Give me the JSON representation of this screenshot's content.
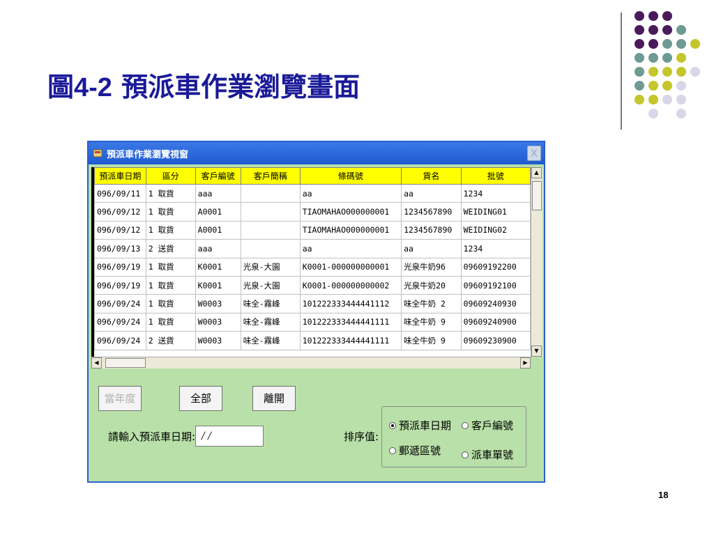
{
  "slide": {
    "title_prefix": "圖",
    "title_num": "4-2",
    "title_text": " 預派車作業瀏覽畫面",
    "page_number": "18",
    "colors": {
      "purple": "#4b1a5c",
      "teal": "#6e9a94",
      "olive": "#c4c62a",
      "lavender": "#d8d6e8"
    }
  },
  "window": {
    "title": "預派車作業瀏覽視窗",
    "close_label": "X"
  },
  "grid": {
    "columns": [
      "預派車日期",
      "區分",
      "客戶編號",
      "客戶簡稱",
      "條碼號",
      "貨名",
      "批號"
    ],
    "rows": [
      [
        "096/09/11",
        "1 取貨",
        "aaa",
        "",
        "aa",
        "aa",
        "1234"
      ],
      [
        "096/09/12",
        "1 取貨",
        "A0001",
        "",
        "TIAOMAHAO000000001",
        "1234567890",
        "WEIDING01"
      ],
      [
        "096/09/12",
        "1 取貨",
        "A0001",
        "",
        "TIAOMAHAO000000001",
        "1234567890",
        "WEIDING02"
      ],
      [
        "096/09/13",
        "2 送貨",
        "aaa",
        "",
        "aa",
        "aa",
        "1234"
      ],
      [
        "096/09/19",
        "1 取貨",
        "K0001",
        "光泉-大園",
        "K0001-000000000001",
        "光泉牛奶96",
        "09609192200"
      ],
      [
        "096/09/19",
        "1 取貨",
        "K0001",
        "光泉-大園",
        "K0001-000000000002",
        "光泉牛奶20",
        "09609192100"
      ],
      [
        "096/09/24",
        "1 取貨",
        "W0003",
        "味全-霧峰",
        "101222333444441112",
        "味全牛奶 2",
        "09609240930"
      ],
      [
        "096/09/24",
        "1 取貨",
        "W0003",
        "味全-霧峰",
        "101222333444441111",
        "味全牛奶 9",
        "09609240900"
      ],
      [
        "096/09/24",
        "2 送貨",
        "W0003",
        "味全-霧峰",
        "101222333444441111",
        "味全牛奶 9",
        "09609230900"
      ]
    ]
  },
  "controls": {
    "current_year_button": "當年度",
    "all_button": "全部",
    "leave_button": "離開",
    "date_label": "請輸入預派車日期:",
    "date_value": "/ /",
    "sort_label": "排序值:",
    "sort_options": [
      "預派車日期",
      "客戶編號",
      "郵遞區號",
      "派車單號"
    ],
    "sort_selected": "預派車日期"
  }
}
